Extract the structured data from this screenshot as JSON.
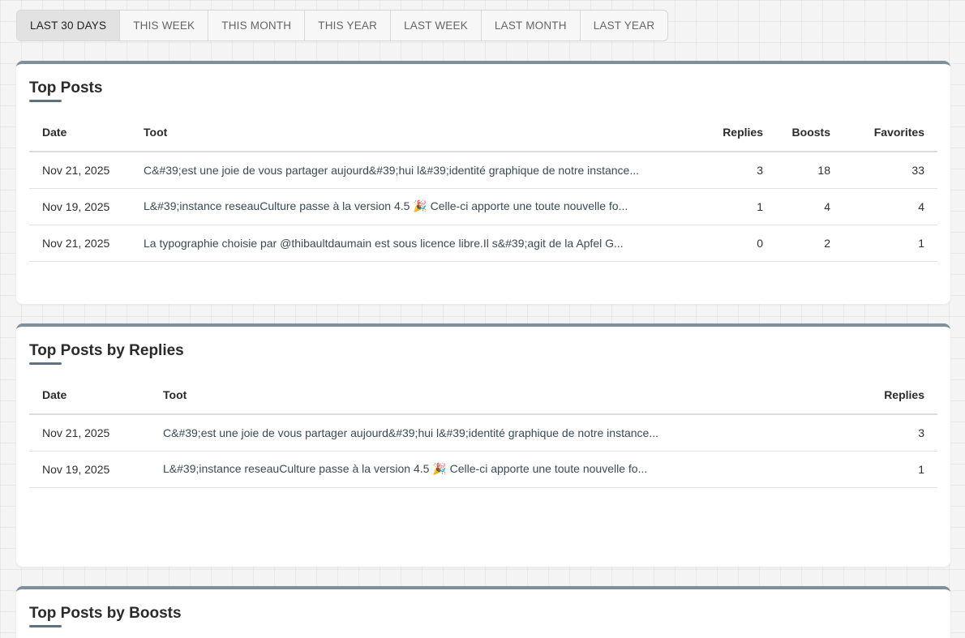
{
  "range_tabs": [
    {
      "label": "LAST 30 DAYS",
      "active": true
    },
    {
      "label": "THIS WEEK",
      "active": false
    },
    {
      "label": "THIS MONTH",
      "active": false
    },
    {
      "label": "THIS YEAR",
      "active": false
    },
    {
      "label": "LAST WEEK",
      "active": false
    },
    {
      "label": "LAST MONTH",
      "active": false
    },
    {
      "label": "LAST YEAR",
      "active": false
    }
  ],
  "colors": {
    "card_accent": "#7d8f9a",
    "title_underline": "#5e7180",
    "active_tab_bg": "#e2e2e2"
  },
  "top_posts": {
    "title": "Top Posts",
    "headers": {
      "date": "Date",
      "toot": "Toot",
      "replies": "Replies",
      "boosts": "Boosts",
      "favorites": "Favorites"
    },
    "rows": [
      {
        "date": "Nov 21, 2025",
        "toot": "C&#39;est une joie de vous partager aujourd&#39;hui l&#39;identité graphique de notre instance...",
        "replies": "3",
        "boosts": "18",
        "favorites": "33"
      },
      {
        "date": "Nov 19, 2025",
        "toot": "L&#39;instance reseauCulture passe à la version 4.5 🎉 Celle-ci apporte une toute nouvelle fo...",
        "replies": "1",
        "boosts": "4",
        "favorites": "4"
      },
      {
        "date": "Nov 21, 2025",
        "toot": "La typographie choisie par @thibaultdaumain est sous licence libre.Il s&#39;agit de la Apfel G...",
        "replies": "0",
        "boosts": "2",
        "favorites": "1"
      }
    ]
  },
  "top_by_replies": {
    "title": "Top Posts by Replies",
    "headers": {
      "date": "Date",
      "toot": "Toot",
      "replies": "Replies"
    },
    "rows": [
      {
        "date": "Nov 21, 2025",
        "toot": "C&#39;est une joie de vous partager aujourd&#39;hui l&#39;identité graphique de notre instance...",
        "replies": "3"
      },
      {
        "date": "Nov 19, 2025",
        "toot": "L&#39;instance reseauCulture passe à la version 4.5 🎉 Celle-ci apporte une toute nouvelle fo...",
        "replies": "1"
      }
    ]
  },
  "top_by_boosts": {
    "title": "Top Posts by Boosts"
  }
}
